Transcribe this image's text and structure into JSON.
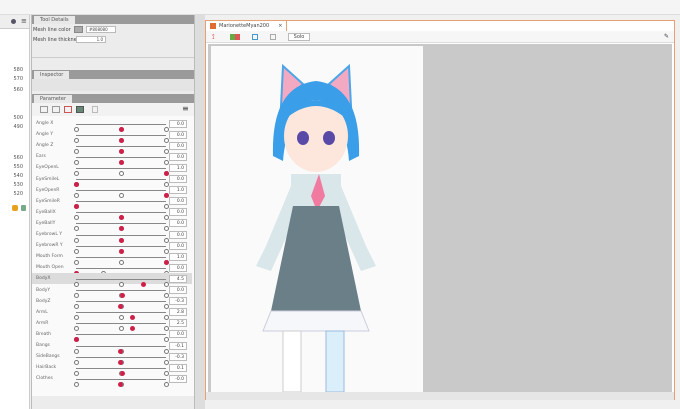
{
  "tool_details": {
    "tab": "Tool Details",
    "mesh_line_color_label": "Mesh line color",
    "mesh_line_color_value": "#808080",
    "mesh_line_thickness_label": "Mesh line thickness",
    "mesh_line_thickness_value": "1.0"
  },
  "inspector": {
    "tab": "Inspector"
  },
  "parameter": {
    "tab": "Parameter",
    "items": [
      {
        "label": "Angle X",
        "value": "0.0",
        "pos": 0.5,
        "def": 0.5
      },
      {
        "label": "Angle Y",
        "value": "0.0",
        "pos": 0.5,
        "def": 0.5
      },
      {
        "label": "Angle Z",
        "value": "0.0",
        "pos": 0.5,
        "def": 0.5
      },
      {
        "label": "Ears",
        "value": "0.0",
        "pos": 0.5,
        "def": 0.5
      },
      {
        "label": "EyeOpenL",
        "value": "1.0",
        "pos": 1.0,
        "def": 0.5
      },
      {
        "label": "EyeSmileL",
        "value": "0.0",
        "pos": 0.0,
        "def": 0.0
      },
      {
        "label": "EyeOpenR",
        "value": "1.0",
        "pos": 1.0,
        "def": 0.5
      },
      {
        "label": "EyeSmileR",
        "value": "0.0",
        "pos": 0.0,
        "def": 0.0
      },
      {
        "label": "EyeBallX",
        "value": "0.0",
        "pos": 0.5,
        "def": 0.5
      },
      {
        "label": "EyeBallY",
        "value": "0.0",
        "pos": 0.51,
        "def": 0.5
      },
      {
        "label": "EyebrowL Y",
        "value": "0.0",
        "pos": 0.51,
        "def": 0.5
      },
      {
        "label": "EyebrowR Y",
        "value": "0.0",
        "pos": 0.5,
        "def": 0.5
      },
      {
        "label": "Mouth Form",
        "value": "1.0",
        "pos": 1.0,
        "def": 0.5
      },
      {
        "label": "Mouth Open",
        "value": "0.0",
        "pos": 0.0,
        "def": 0.3
      },
      {
        "label": "BodyX",
        "value": "4.5",
        "pos": 0.75,
        "def": 0.5
      },
      {
        "label": "BodyY",
        "value": "0.0",
        "pos": 0.52,
        "def": 0.5
      },
      {
        "label": "BodyZ",
        "value": "-0.3",
        "pos": 0.49,
        "def": 0.5
      },
      {
        "label": "ArmL",
        "value": "2.8",
        "pos": 0.63,
        "def": 0.5
      },
      {
        "label": "ArmR",
        "value": "2.5",
        "pos": 0.63,
        "def": 0.5
      },
      {
        "label": "Breath",
        "value": "0.0",
        "pos": 0.0,
        "def": 0.0
      },
      {
        "label": "Bangs",
        "value": "-0.1",
        "pos": 0.49,
        "def": 0.5
      },
      {
        "label": "SideBangs",
        "value": "-0.3",
        "pos": 0.49,
        "def": 0.5
      },
      {
        "label": "HairBack",
        "value": "0.1",
        "pos": 0.52,
        "def": 0.5
      },
      {
        "label": "Clothes",
        "value": "-0.0",
        "pos": 0.49,
        "def": 0.5
      }
    ]
  },
  "left_numbers": [
    "580",
    "570",
    "560",
    "500",
    "490",
    "560",
    "550",
    "540",
    "530",
    "520"
  ],
  "view": {
    "tab_title": "MarionetteMyan200",
    "solo_button": "Solo"
  }
}
